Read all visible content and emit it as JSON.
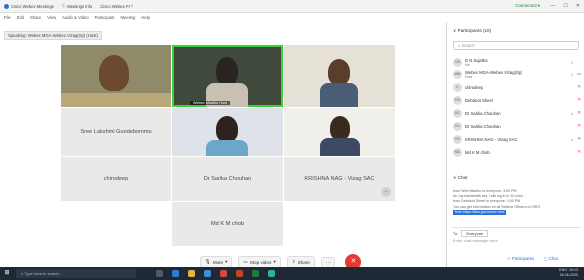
{
  "titlebar": {
    "tabs": [
      "Cisco Webex Meetings",
      "Meetings Info",
      "Cisco Webex Fr"
    ],
    "status": "Connected",
    "window_controls": [
      "—",
      "☐",
      "✕"
    ]
  },
  "menubar": {
    "items": [
      "File",
      "Edit",
      "Share",
      "View",
      "Audio & Video",
      "Participant",
      "Meeting",
      "Help"
    ]
  },
  "speaking": "Speaking: Webex MGA-Webex Vizag(Sp) (Host)",
  "tiles": {
    "sree": "Sree Lakshmi Gundebommu",
    "active_tag": "Webex Mladhu Host",
    "chirodeep": "chirodeep",
    "sarika": "Dr Sarika Chouhan",
    "krishna": "KRISHNA NAG - Vizag SAC",
    "md": "Md K M chob"
  },
  "controls": {
    "mute": "Mute",
    "stop_video": "Stop video",
    "share": "Share",
    "more": "···"
  },
  "panel": {
    "header": "Participants (10)",
    "search_placeholder": "Search",
    "participants": [
      {
        "initials": "DS",
        "name": "D N Sujatha",
        "sub": "Me"
      },
      {
        "initials": "WM",
        "name": "Webex MGA-Webex Vizag(Sp)",
        "sub": "Host"
      },
      {
        "initials": "C",
        "name": "chirodeep",
        "sub": ""
      },
      {
        "initials": "DS",
        "name": "Debdoot Sheel",
        "sub": ""
      },
      {
        "initials": "DC",
        "name": "Dr Sarika Chouhan",
        "sub": ""
      },
      {
        "initials": "DC",
        "name": "Dr Sarika Chouhan",
        "sub": ""
      },
      {
        "initials": "KV",
        "name": "KRISHNA NAG - Vizag SAC",
        "sub": ""
      },
      {
        "initials": "MC",
        "name": "Md K M chob",
        "sub": ""
      }
    ],
    "chat": {
      "header": "Chat",
      "messages": [
        "from Web Mladhu to everyone: 3:00 PM",
        "sir, my bandwidth low, I will log in in 10 mins",
        "from Debdoot Sheel to everyone: 3:00 PM",
        "You can get information on all Section Officers of ISRO"
      ],
      "link": "from https://isro.gov.in/sec.html",
      "to_label": "To:",
      "to_value": "Everyone",
      "input_placeholder": "Enter chat message here"
    },
    "footer": {
      "participants": "Participants",
      "chat": "Chat"
    }
  },
  "taskbar": {
    "search": "Type here to search",
    "time": "15:13",
    "date": "26-06-2020",
    "lang": "ENG"
  },
  "colors": {
    "active_border": "#3ad13a",
    "link_bg": "#2f6fd6",
    "leave": "#e53935",
    "taskbar": "#1f2936"
  }
}
